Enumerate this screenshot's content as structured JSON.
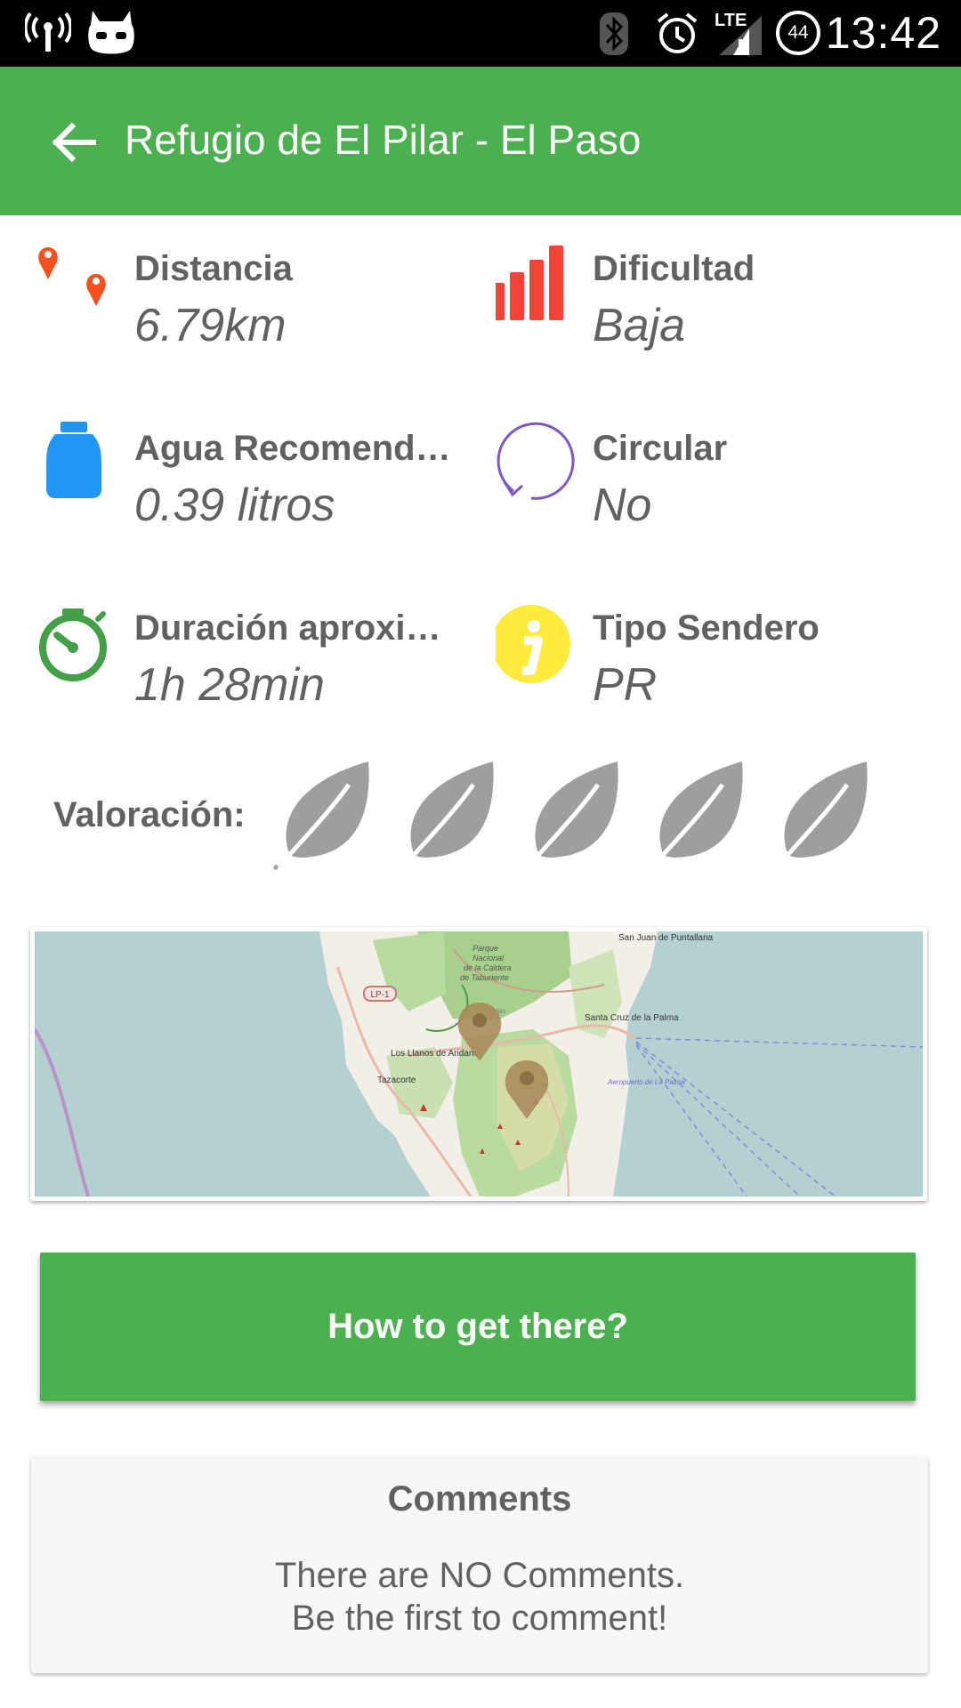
{
  "status_bar": {
    "time": "13:42",
    "network_type": "LTE",
    "battery_level": "44",
    "icons": [
      "wireless-hotspot-icon",
      "cyanogenmod-mascot-icon",
      "bluetooth-icon",
      "alarm-clock-icon",
      "signal-icon",
      "battery-icon"
    ]
  },
  "app_bar": {
    "title": "Refugio de El Pilar - El Paso",
    "back_icon": "arrow-left-icon",
    "color": "#4caf50"
  },
  "info": [
    {
      "label": "Distancia",
      "value": "6.79km",
      "icon": "map-markers-icon"
    },
    {
      "label": "Dificultad",
      "value": "Baja",
      "icon": "signal-bars-icon"
    },
    {
      "label": "Agua Recomendada",
      "value": "0.39 litros",
      "icon": "water-jug-icon"
    },
    {
      "label": "Circular",
      "value": "No",
      "icon": "circular-arrow-icon"
    },
    {
      "label": "Duración aproximada",
      "value": "1h 28min",
      "icon": "stopwatch-icon"
    },
    {
      "label": "Tipo Sendero",
      "value": "PR",
      "icon": "info-icon"
    }
  ],
  "rating": {
    "label": "Valoración:",
    "max": 5,
    "value": 0,
    "icon": "leaf-icon"
  },
  "map": {
    "labels": {
      "north_town": "San Juan de Puntallana",
      "park_1": "Parque",
      "park_2": "Nacional",
      "park_3": "de la Caldera",
      "park_4": "de Taburiente",
      "capital": "Santa Cruz de la Palma",
      "town_west": "Los Llanos de Aridane",
      "town_tazacorte": "Tazacorte",
      "road": "LP-1",
      "airport": "Aeropuerto de La Palma",
      "small": "arias"
    }
  },
  "directions_button": {
    "label": "How to get there?"
  },
  "comments": {
    "title": "Comments",
    "message_line1": "There are NO Comments.",
    "message_line2": "Be the first to comment!"
  },
  "colors": {
    "primary": "#4caf50",
    "text": "#616161",
    "marker": "#f4511e",
    "difficulty": "#f44336",
    "water": "#2196f3",
    "circular": "#7e57c2",
    "stopwatch": "#43a047",
    "info": "#ffeb3b",
    "leaf": "#9e9e9e"
  }
}
